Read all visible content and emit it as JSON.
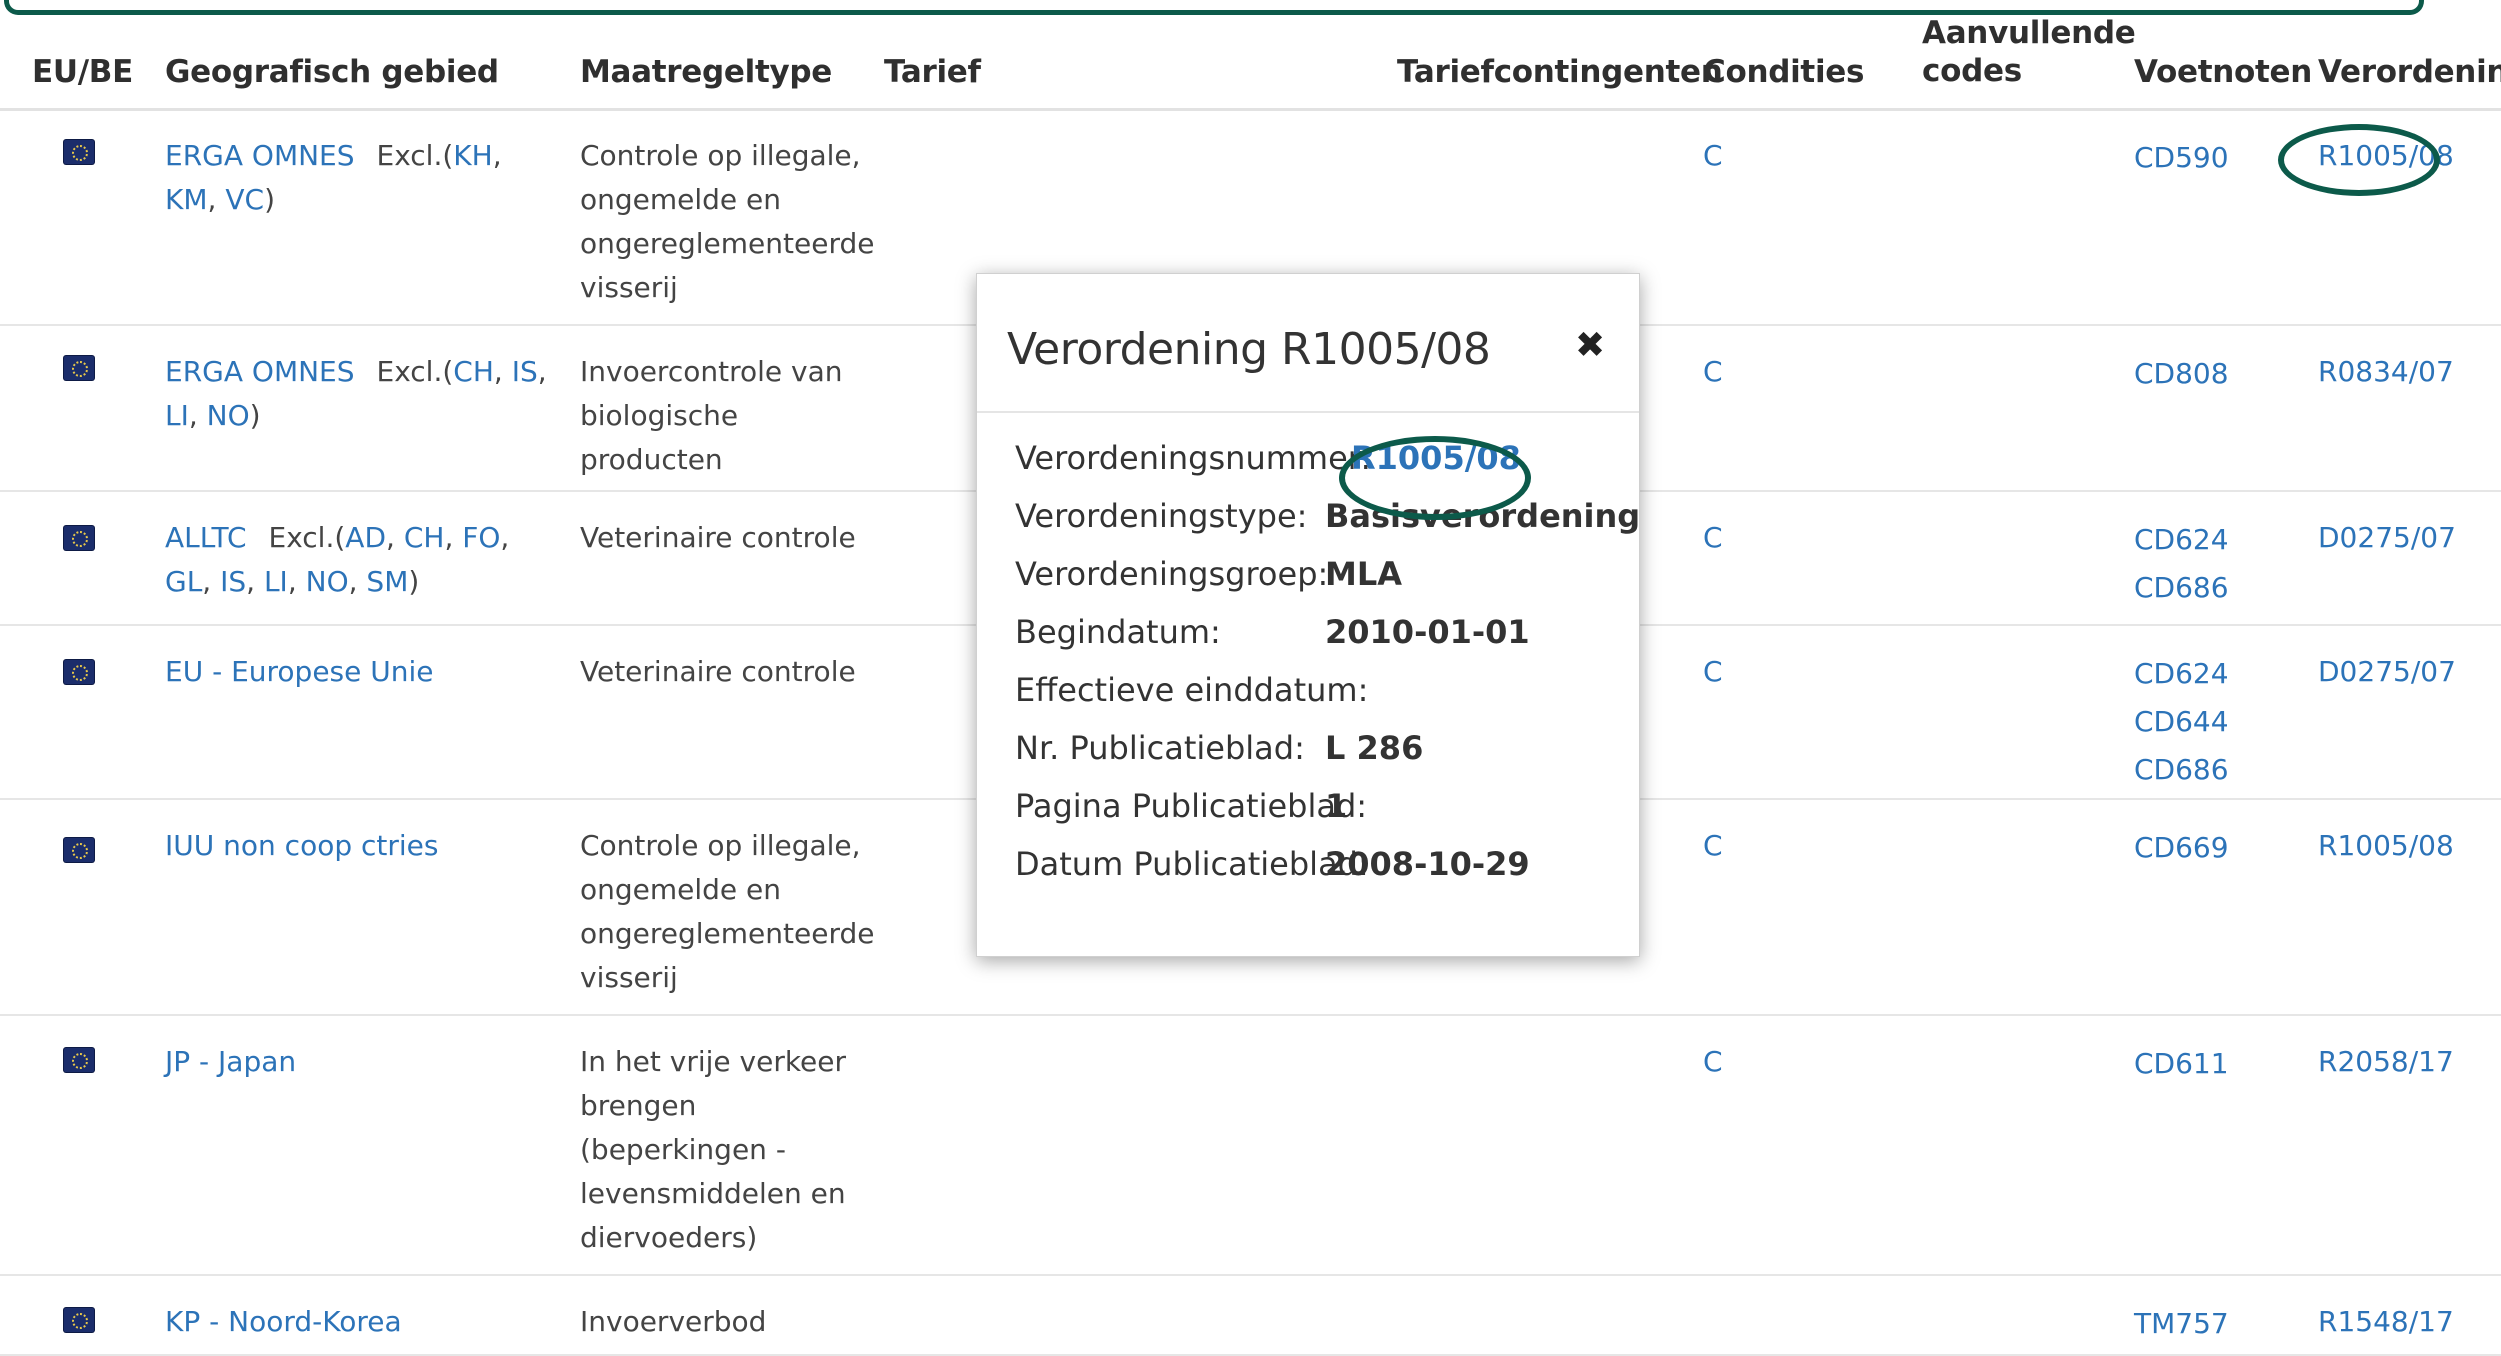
{
  "headers": {
    "eubel": "EU/BE",
    "geo": "Geografisch gebied",
    "maat": "Maatregeltype",
    "tarief": "Tarief",
    "tariefcont": "Tariefcontingenten",
    "condities": "Condities",
    "aanvullende_1": "Aanvullende",
    "aanvullende_2": "codes",
    "voetnoten": "Voetnoten",
    "verordening": "Verordening"
  },
  "rows": [
    {
      "geo_name": "ERGA OMNES",
      "geo_excl_prefix": "Excl.(",
      "geo_excl_list": [
        "KH",
        "KM",
        "VC"
      ],
      "maatregel": [
        "Controle op illegale,",
        "ongemelde en",
        "ongereglementeerde",
        "visserij"
      ],
      "condities": "C",
      "voetnoten": [
        "CD590"
      ],
      "verordening": "R1005/08"
    },
    {
      "geo_name": "ERGA OMNES",
      "geo_excl_prefix": "Excl.(",
      "geo_excl_list": [
        "CH",
        "IS",
        "LI",
        "NO"
      ],
      "maatregel": [
        "Invoercontrole van",
        "biologische",
        "producten"
      ],
      "condities": "C",
      "voetnoten": [
        "CD808"
      ],
      "verordening": "R0834/07"
    },
    {
      "geo_name": "ALLTC",
      "geo_excl_prefix": "Excl.(",
      "geo_excl_list": [
        "AD",
        "CH",
        "FO",
        "GL",
        "IS",
        "LI",
        "NO",
        "SM"
      ],
      "maatregel": [
        "Veterinaire controle"
      ],
      "condities": "C",
      "voetnoten": [
        "CD624",
        "CD686"
      ],
      "verordening": "D0275/07"
    },
    {
      "geo_name": "EU - Europese Unie",
      "maatregel": [
        "Veterinaire controle"
      ],
      "condities": "C",
      "voetnoten": [
        "CD624",
        "CD644",
        "CD686"
      ],
      "verordening": "D0275/07"
    },
    {
      "geo_name": "IUU non coop ctries",
      "maatregel": [
        "Controle op illegale,",
        "ongemelde en",
        "ongereglementeerde",
        "visserij"
      ],
      "condities": "C",
      "voetnoten": [
        "CD669"
      ],
      "verordening": "R1005/08"
    },
    {
      "geo_name": "JP - Japan",
      "maatregel": [
        "In het vrije verkeer",
        "brengen",
        "(beperkingen -",
        "levensmiddelen en",
        "diervoeders)"
      ],
      "condities": "C",
      "voetnoten": [
        "CD611"
      ],
      "verordening": "R2058/17"
    },
    {
      "geo_name": "KP - Noord-Korea",
      "maatregel": [
        "Invoerverbod"
      ],
      "condities": "",
      "voetnoten": [
        "TM757"
      ],
      "verordening": "R1548/17"
    }
  ],
  "popup": {
    "title": "Verordening R1005/08",
    "close": "✖",
    "fields": [
      {
        "label": "Verordeningsnummer:",
        "value": "R1005/08"
      },
      {
        "label": "Verordeningstype:",
        "value": "Basisverordening"
      },
      {
        "label": "Verordeningsgroep:",
        "value": "MLA"
      },
      {
        "label": "Begindatum:",
        "value": "2010-01-01"
      },
      {
        "label": "Effectieve einddatum:",
        "value": ""
      },
      {
        "label": "Nr. Publicatieblad:",
        "value": "L 286"
      },
      {
        "label": "Pagina Publicatieblad:",
        "value": "1"
      },
      {
        "label": "Datum Publicatieblad:",
        "value": "2008-10-29"
      }
    ]
  },
  "colors": {
    "link": "#2c73b8",
    "highlight": "#0c5a4a"
  }
}
